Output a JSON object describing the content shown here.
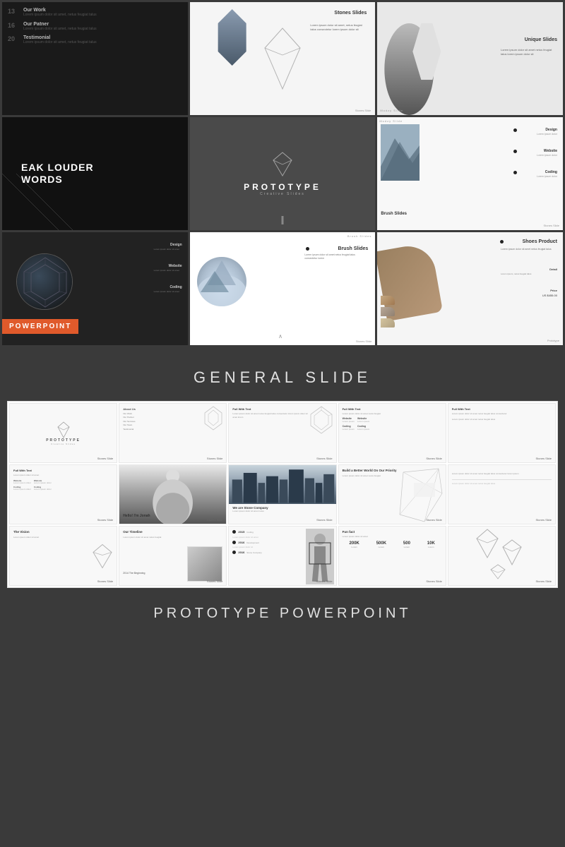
{
  "top_grid": {
    "slides": [
      {
        "id": "slide-list",
        "type": "dark-list",
        "items": [
          {
            "num": "13",
            "title": "Our Work",
            "text": "Lorem ipsum dolor sit amet, netus feugiat talus"
          },
          {
            "num": "16",
            "title": "Our Patner",
            "text": "Lorem ipsum dolor sit amet, netus feugiat talus"
          },
          {
            "num": "20",
            "title": "Testimonial",
            "text": "Lorem ipsum dolor sit amet, netus feugiat talus"
          }
        ]
      },
      {
        "id": "stones-slides",
        "type": "light-gem",
        "title": "Stones Slides",
        "description": "Lorem ipsum dolor sit amet, netus feugiat talus consectetur lorem ipsum dolor sit"
      },
      {
        "id": "unique-slides",
        "type": "person-photo",
        "title": "Unique Slides",
        "description": "Lorem ipsum dolor sit amet netus feugiat talus lorem ipsum dolor sit"
      },
      {
        "id": "speak-louder",
        "type": "dark-text",
        "line1": "EAK LOUDER",
        "line2": "WORDS"
      },
      {
        "id": "prototype-main",
        "type": "prototype-center",
        "title": "PROTOTYPE",
        "subtitle": "Creative Slides"
      },
      {
        "id": "brush-slides-top",
        "type": "brush-preview",
        "label": "Brush Slides",
        "design": "Design",
        "website": "Website",
        "coding": "Coding"
      },
      {
        "id": "design-powerpoint",
        "type": "dark-pp",
        "badge": "POWERPOINT",
        "design": "Design",
        "website": "Website"
      },
      {
        "id": "brush-slides-mid",
        "type": "brush-mountain",
        "title": "Brush Slides",
        "description": "Lorem ipsum dolor sit amet netus feugiat talus consectetur lorem"
      },
      {
        "id": "shoes-product",
        "type": "shoes",
        "title": "Shoes Product",
        "description": "Lorem ipsum dolor sit amet netus feugiat talus",
        "detail": "Detail",
        "price_label": "Price",
        "price": "US $455.00"
      }
    ]
  },
  "section1": {
    "label": "GENERAL SLIDE"
  },
  "bottom_grid": {
    "rows": [
      [
        {
          "type": "proto-logo",
          "title": "PROTOTYPE",
          "sub": "Creative Slides"
        },
        {
          "type": "list-items",
          "title": "About Us",
          "items": [
            "Our Work",
            "Our Partner",
            "Our Services",
            "Our Team",
            "Testimonial"
          ]
        },
        {
          "type": "text-geo",
          "title": "Full With Text"
        },
        {
          "type": "text-only",
          "title": "Full With Text"
        },
        {
          "type": "text-only2",
          "title": "Full With Text"
        }
      ],
      [
        {
          "type": "text-small",
          "title": "Full With Text"
        },
        {
          "type": "person-bw",
          "title": "Hello! I'm Jonah"
        },
        {
          "type": "city-photo",
          "title": "We are Stone Company"
        },
        {
          "type": "geo-abstract",
          "title": "Build a Better World On Our Priority"
        },
        {
          "type": "text-lines",
          "title": ""
        }
      ],
      [
        {
          "type": "vision",
          "title": "The Vision"
        },
        {
          "type": "timeline",
          "title": "Our Timeline"
        },
        {
          "type": "timeline2",
          "title": "",
          "years": [
            "2015",
            "2016",
            "2016"
          ]
        },
        {
          "type": "stats",
          "title": "Fun fact",
          "stats": [
            "200K",
            "500K",
            "500",
            "10K"
          ]
        },
        {
          "type": "geo-shapes",
          "title": ""
        }
      ]
    ]
  },
  "section2": {
    "label": "PROTOTYPE POWERPOINT"
  }
}
